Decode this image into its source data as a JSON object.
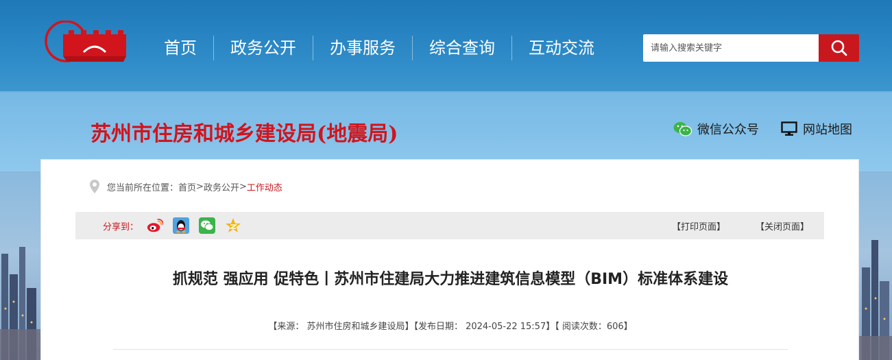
{
  "nav": {
    "items": [
      "首页",
      "政务公开",
      "办事服务",
      "综合查询",
      "互动交流"
    ]
  },
  "search": {
    "placeholder": "请输入搜索关键字",
    "icon": "search-icon"
  },
  "header": {
    "site_title": "苏州市住房和城乡建设局(地震局)",
    "wechat_label": "微信公众号",
    "sitemap_label": "网站地图"
  },
  "breadcrumb": {
    "prefix": "您当前所在位置：",
    "home": "首页",
    "sep1": ">",
    "section": "政务公开",
    "sep2": ">",
    "current": "工作动态"
  },
  "share": {
    "label": "分享到：",
    "targets": [
      "weibo-icon",
      "qq-icon",
      "wechat-icon",
      "qzone-icon"
    ],
    "print_label": "【打印页面】",
    "close_label": "【关闭页面】"
  },
  "article": {
    "title": "抓规范 强应用 促特色丨苏州市住建局大力推进建筑信息模型（BIM）标准体系建设",
    "meta": "【来源： 苏州市住房和城乡建设局】【发布日期： 2024-05-22 15:57】【 阅读次数：606】"
  },
  "colors": {
    "brand_red": "#c9171e",
    "nav_blue": "#2c89c6"
  }
}
